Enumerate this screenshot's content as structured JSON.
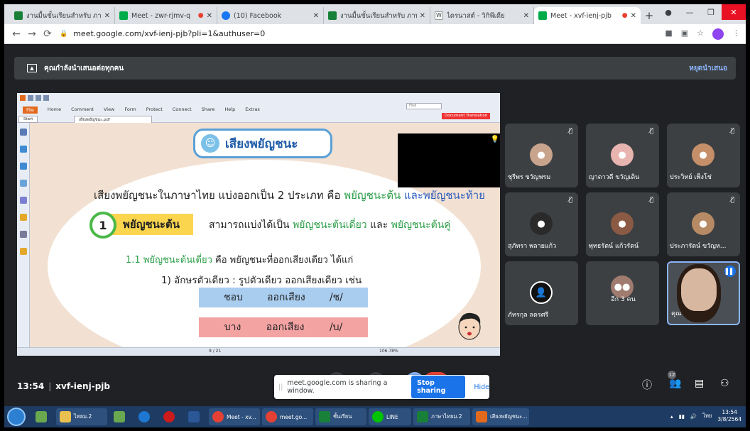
{
  "browser": {
    "tabs": [
      {
        "title": "งานมื้นขั้นเรียนสำหรับ ภาษา",
        "fav_color": "#188038",
        "active": false,
        "recording": false
      },
      {
        "title": "Meet - zwr-rjmv-q",
        "fav_color": "#00ac47",
        "active": false,
        "recording": true
      },
      {
        "title": "(10) Facebook",
        "fav_color": "#1877f2",
        "active": false,
        "recording": false
      },
      {
        "title": "งานมื้นขั้นเรียนสำหรับ ภาษา",
        "fav_color": "#188038",
        "active": false,
        "recording": false
      },
      {
        "title": "ไดรนาสต์ - วิกิพีเดีย",
        "fav_color": "#ffffff",
        "active": false,
        "recording": false
      },
      {
        "title": "Meet - xvf-ienj-pjb",
        "fav_color": "#00ac47",
        "active": true,
        "recording": true
      }
    ],
    "url": "meet.google.com/xvf-ienj-pjb?pli=1&authuser=0"
  },
  "presenting_bar": {
    "text": "คุณกำลังนำเสนอต่อทุกคน",
    "stop_label": "หยุดนำเสนอ"
  },
  "reader": {
    "menu": [
      "File",
      "Home",
      "Comment",
      "View",
      "Form",
      "Protect",
      "Connect",
      "Share",
      "Help",
      "Extras"
    ],
    "doc_tab_start": "Start",
    "doc_tab_file": "เสียงพยัญชนะ.pdf",
    "find_placeholder": "Find",
    "translation_label": "Document Translation",
    "page_indicator": "9 / 21",
    "zoom": "106.78%"
  },
  "slide": {
    "title": "เสียงพยัญชนะ",
    "line1_a": "เสียงพยัญชนะในภาษาไทย แบ่งออกเป็น 2 ประเภท คือ ",
    "line1_b": "พยัญชนะต้น",
    "line1_c": " และ",
    "line1_d": "พยัญชนะท้าย",
    "number": "1",
    "heading": "พยัญชนะต้น",
    "line2_a": "สามารถแบ่งได้เป็น ",
    "line2_b": "พยัญชนะต้นเดี่ยว",
    "line2_c": " และ ",
    "line2_d": "พยัญชนะต้นคู่",
    "line3_a": "1.1 ",
    "line3_b": "พยัญชนะต้นเดี่ยว",
    "line3_c": " คือ พยัญชนะที่ออกเสียงเดียว ได้แก่",
    "line4": "1) อักษรตัวเดียว : รูปตัวเดียว ออกเสียงเดียว เช่น",
    "rows": [
      {
        "word": "ชอบ",
        "mid": "ออกเสียง",
        "sound": "/ช/"
      },
      {
        "word": "บาง",
        "mid": "ออกเสียง",
        "sound": "/บ/"
      }
    ]
  },
  "participants": [
    {
      "name": "ชุรีพร ขวัญพรม",
      "color": "#c9a48c",
      "muted": true
    },
    {
      "name": "ญาดาวดี ขวัญเดิน",
      "color": "#e8b4b0",
      "muted": true
    },
    {
      "name": "ประวิทย์ เพ็งโช่",
      "color": "#c58f6a",
      "muted": true
    },
    {
      "name": "สุภัทรา พลายแก้ว",
      "color": "#2a2a2a",
      "muted": true
    },
    {
      "name": "พุทธรัตน์ แก้วรัตน์",
      "color": "#8a5a44",
      "muted": true
    },
    {
      "name": "ประภารัตน์ ขวัญห...",
      "color": "#b78a66",
      "muted": true
    },
    {
      "name": "ภัทรกุล ลดรศรี",
      "color": "#111111",
      "muted": false
    },
    {
      "name": "อีก 3 คน",
      "color": "#a07c70",
      "muted": false
    },
    {
      "name": "คุณ",
      "color": "#d8b7a0",
      "muted": false
    }
  ],
  "meet_bottom": {
    "time": "13:54",
    "meeting_code": "xvf-ienj-pjb",
    "share_text": "meet.google.com is sharing a window.",
    "stop_sharing": "Stop sharing",
    "hide": "Hide",
    "people_count": "12"
  },
  "taskbar": {
    "items": [
      {
        "label": "ไทยม.2",
        "color": "#e8c050"
      },
      {
        "label": "Meet - xv...",
        "color": "#e44134"
      },
      {
        "label": "meet.go...",
        "color": "#e44134"
      },
      {
        "label": "ชั้นเรียน",
        "color": "#188038"
      },
      {
        "label": "ภาษาไทยม.2",
        "color": "#188038"
      },
      {
        "label": "เสียงพยัญชนะ...",
        "color": "#e36a1d"
      }
    ],
    "line_label": "LINE",
    "lang": "ไทย",
    "clock_time": "13:54",
    "clock_date": "3/8/2564"
  }
}
